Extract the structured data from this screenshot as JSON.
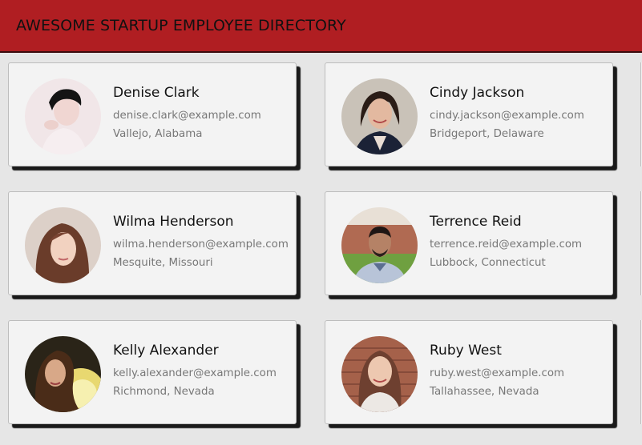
{
  "header": {
    "title": "AWESOME STARTUP EMPLOYEE DIRECTORY"
  },
  "employees": [
    {
      "name": "Denise Clark",
      "email": "denise.clark@example.com",
      "location": "Vallejo, Alabama"
    },
    {
      "name": "Cindy Jackson",
      "email": "cindy.jackson@example.com",
      "location": "Bridgeport, Delaware"
    },
    {
      "name": "Wilma Henderson",
      "email": "wilma.henderson@example.com",
      "location": "Mesquite, Missouri"
    },
    {
      "name": "Terrence Reid",
      "email": "terrence.reid@example.com",
      "location": "Lubbock, Connecticut"
    },
    {
      "name": "Kelly Alexander",
      "email": "kelly.alexander@example.com",
      "location": "Richmond, Nevada"
    },
    {
      "name": "Ruby West",
      "email": "ruby.west@example.com",
      "location": "Tallahassee, Nevada"
    }
  ],
  "colors": {
    "header_bg": "#b01e22",
    "page_bg": "#e6e6e6",
    "card_bg": "#f3f3f3",
    "name_text": "#111111",
    "detail_text": "#777777"
  }
}
